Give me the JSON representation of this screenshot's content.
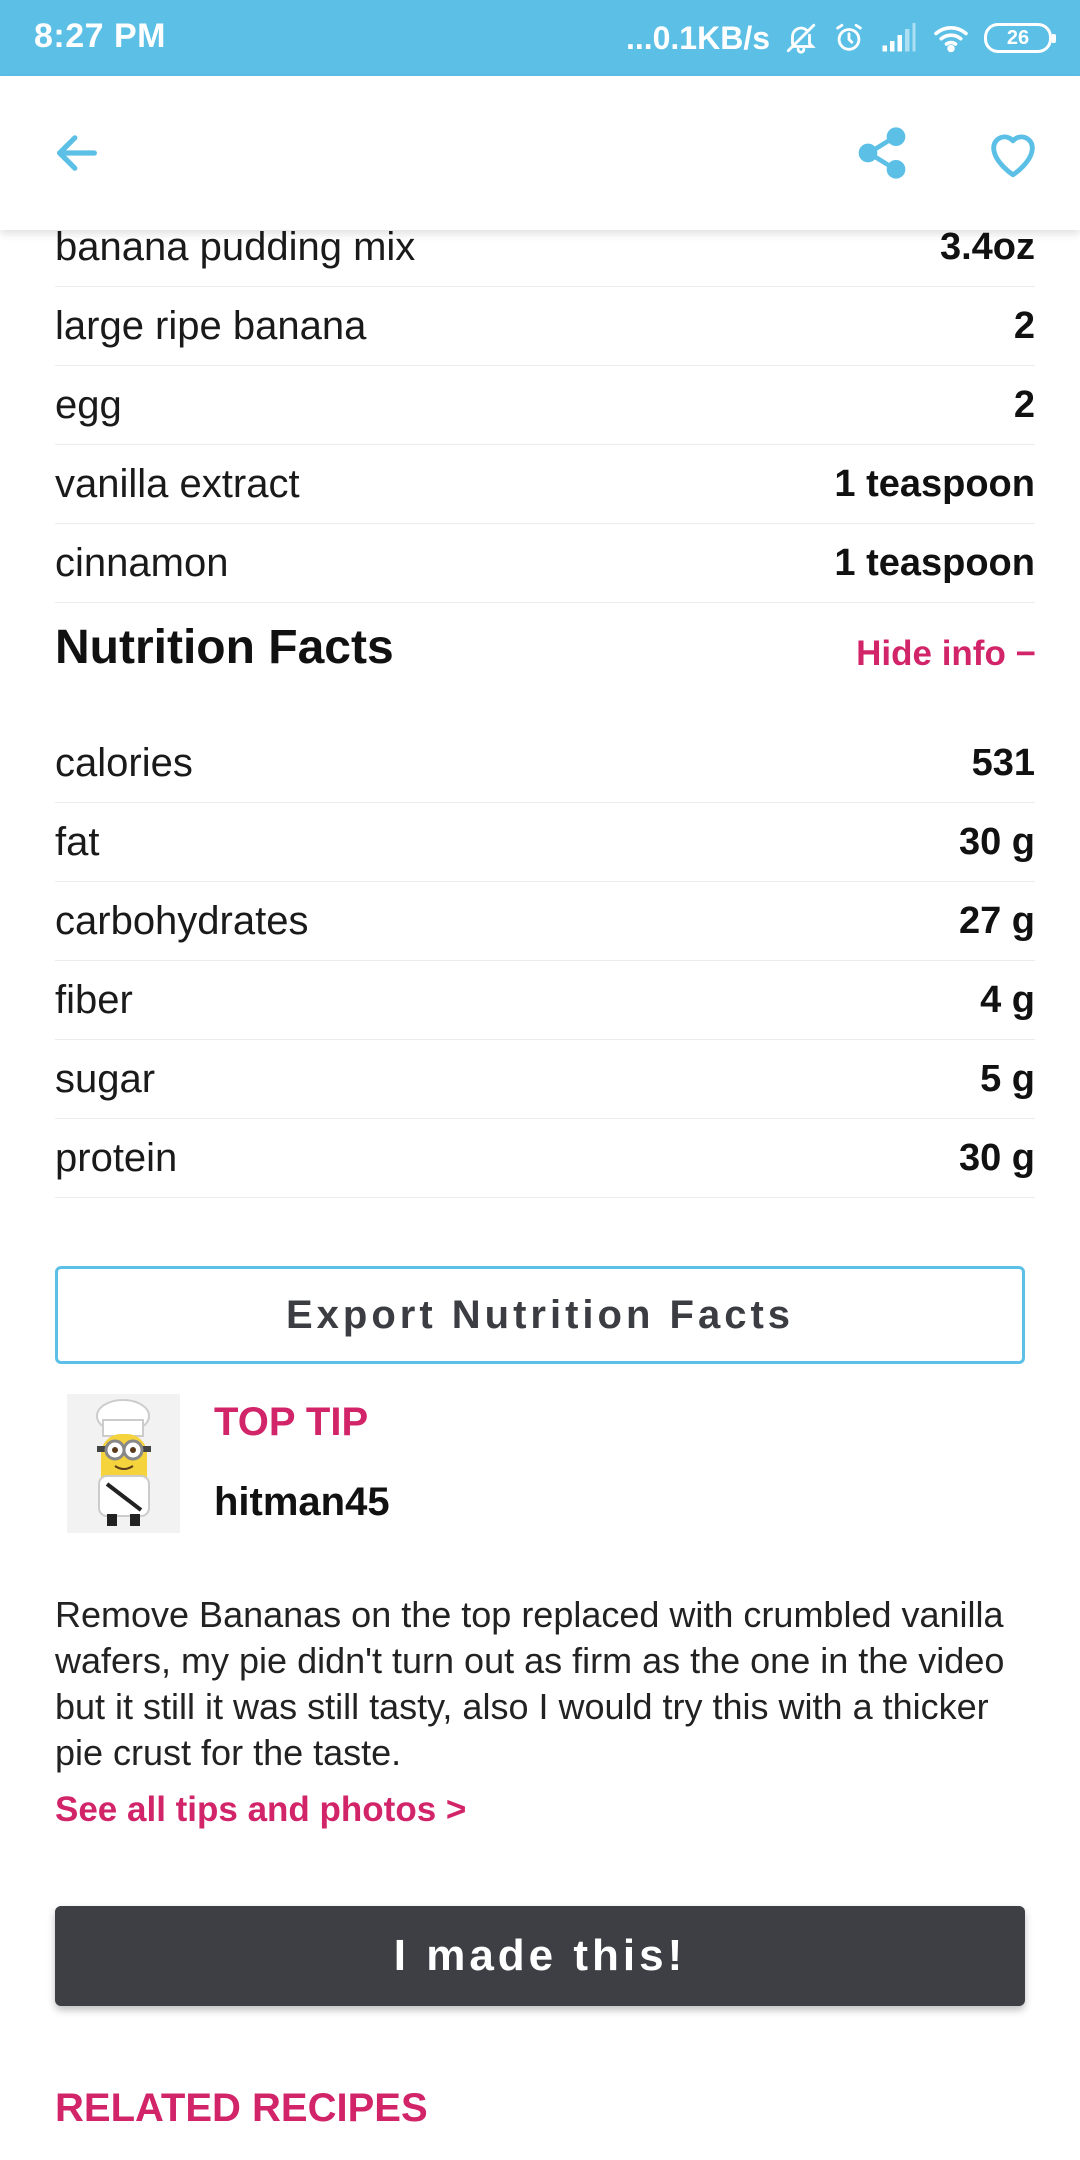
{
  "status_bar": {
    "time": "8:27 PM",
    "network_speed": "...0.1KB/s",
    "battery_level": "26",
    "icons": [
      "mute-icon",
      "alarm-icon",
      "signal-icon",
      "wifi-icon",
      "battery-icon"
    ]
  },
  "app_bar": {
    "icons": [
      "back-arrow-icon",
      "share-icon",
      "heart-icon"
    ],
    "accent_color": "#5bbfe6"
  },
  "ingredients": [
    {
      "name": "banana pudding mix",
      "amount": "3.4oz"
    },
    {
      "name": "large ripe banana",
      "amount": "2"
    },
    {
      "name": "egg",
      "amount": "2"
    },
    {
      "name": "vanilla extract",
      "amount": "1 teaspoon"
    },
    {
      "name": "cinnamon",
      "amount": "1 teaspoon"
    }
  ],
  "nutrition": {
    "title": "Nutrition Facts",
    "toggle_label": "Hide info −",
    "facts": [
      {
        "name": "calories",
        "value": "531"
      },
      {
        "name": "fat",
        "value": "30 g"
      },
      {
        "name": "carbohydrates",
        "value": "27 g"
      },
      {
        "name": "fiber",
        "value": "4 g"
      },
      {
        "name": "sugar",
        "value": "5 g"
      },
      {
        "name": "protein",
        "value": "30 g"
      }
    ],
    "export_label": "Export Nutrition Facts"
  },
  "top_tip": {
    "label": "TOP TIP",
    "user": "hitman45",
    "text": "Remove Bananas on the top replaced with crumbled vanilla wafers, my pie didn't turn out as firm as the one in the video but it still it was still tasty, also I would try this with a thicker pie crust for the taste.",
    "see_all_label": "See all tips and photos >"
  },
  "made_this_label": "I made this!",
  "related_label": "RELATED RECIPES",
  "colors": {
    "pink": "#d22468",
    "dark_button": "#3d3f44",
    "status_bar": "#5bbfe6"
  }
}
